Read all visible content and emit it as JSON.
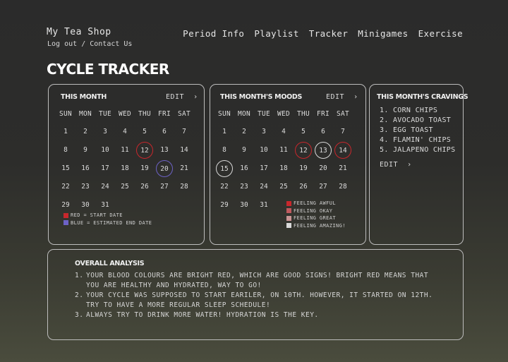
{
  "brand": "My Tea Shop",
  "auth": {
    "logout": "Log out",
    "separator": "/",
    "contact": "Contact Us"
  },
  "nav": [
    "Period Info",
    "Playlist",
    "Tracker",
    "Minigames",
    "Exercise"
  ],
  "page_title": "CYCLE TRACKER",
  "calendar": {
    "title": "THIS MONTH",
    "edit": "EDIT",
    "days_of_week": [
      "SUN",
      "MON",
      "TUE",
      "WED",
      "THU",
      "FRI",
      "SAT"
    ],
    "weeks": [
      [
        "1",
        "2",
        "3",
        "4",
        "5",
        "6",
        "7"
      ],
      [
        "8",
        "9",
        "10",
        "11",
        "12",
        "13",
        "14"
      ],
      [
        "15",
        "16",
        "17",
        "18",
        "19",
        "20",
        "21"
      ],
      [
        "22",
        "23",
        "24",
        "25",
        "26",
        "27",
        "28"
      ],
      [
        "29",
        "30",
        "31",
        "",
        "",
        "",
        ""
      ]
    ],
    "start_date": "12",
    "end_date": "20",
    "legend": [
      {
        "label": "RED  = START DATE",
        "color": "#c8272c"
      },
      {
        "label": "BLUE = ESTIMATED END DATE",
        "color": "#6d62c6"
      }
    ]
  },
  "moods": {
    "title": "THIS MONTH'S MOODS",
    "edit": "EDIT",
    "marked": {
      "12": "#c8272c",
      "13": "#d8d8d8",
      "14": "#c8272c",
      "15": "#d8d8d8"
    },
    "legend": [
      {
        "label": "FEELING AWFUL",
        "color": "#c8272c"
      },
      {
        "label": "FEELING OKAY",
        "color": "#c05a5f"
      },
      {
        "label": "FEELING GREAT",
        "color": "#c99494"
      },
      {
        "label": "FEELING AMAZING!",
        "color": "#dadada"
      }
    ]
  },
  "cravings": {
    "title": "THIS MONTH'S CRAVINGS",
    "edit": "EDIT",
    "items": [
      "CORN CHIPS",
      "AVOCADO TOAST",
      "EGG TOAST",
      "FLAMIN' CHIPS",
      "JALAPENO CHIPS"
    ]
  },
  "analysis": {
    "title": "OVERALL ANALYSIS",
    "items": [
      "YOUR BLOOD COLOURS ARE BRIGHT RED, WHICH ARE GOOD SIGNS! BRIGHT RED MEANS THAT YOU ARE HEALTHY AND HYDRATED, WAY TO GO!",
      "YOUR CYCLE WAS SUPPOSED TO START EARILER, ON 10TH. HOWEVER, IT STARTED ON 12TH. TRY TO HAVE A MORE REGULAR SLEEP SCHEDULE!",
      "ALWAYS TRY TO DRINK MORE WATER! HYDRATION IS THE KEY."
    ]
  }
}
